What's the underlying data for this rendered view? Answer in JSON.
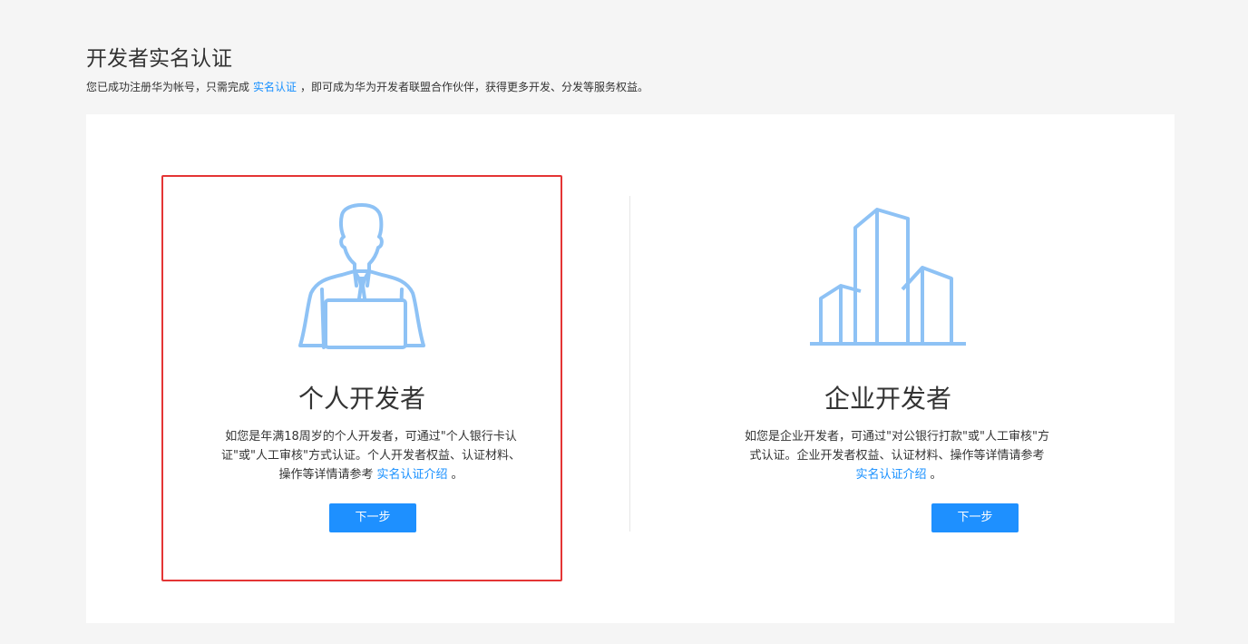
{
  "header": {
    "title": "开发者实名认证",
    "desc_prefix": "您已成功注册华为帐号，只需完成",
    "desc_link": "实名认证",
    "desc_suffix": "，即可成为华为开发者联盟合作伙伴，获得更多开发、分发等服务权益。"
  },
  "options": {
    "personal": {
      "icon": "person-laptop-icon",
      "title": "个人开发者",
      "desc": "如您是年满18周岁的个人开发者，可通过\"个人银行卡认证\"或\"人工审核\"方式认证。个人开发者权益、认证材料、操作等详情请参考",
      "link": "实名认证介绍",
      "desc_end": "。",
      "button": "下一步"
    },
    "enterprise": {
      "icon": "buildings-icon",
      "title": "企业开发者",
      "desc": "如您是企业开发者，可通过\"对公银行打款\"或\"人工审核\"方式认证。企业开发者权益、认证材料、操作等详情请参考",
      "link": "实名认证介绍",
      "desc_end": "。",
      "button": "下一步"
    }
  },
  "colors": {
    "accent": "#1e90ff",
    "selected_border": "#e43535",
    "icon_stroke": "#8ec2f5",
    "background": "#f5f5f5"
  }
}
